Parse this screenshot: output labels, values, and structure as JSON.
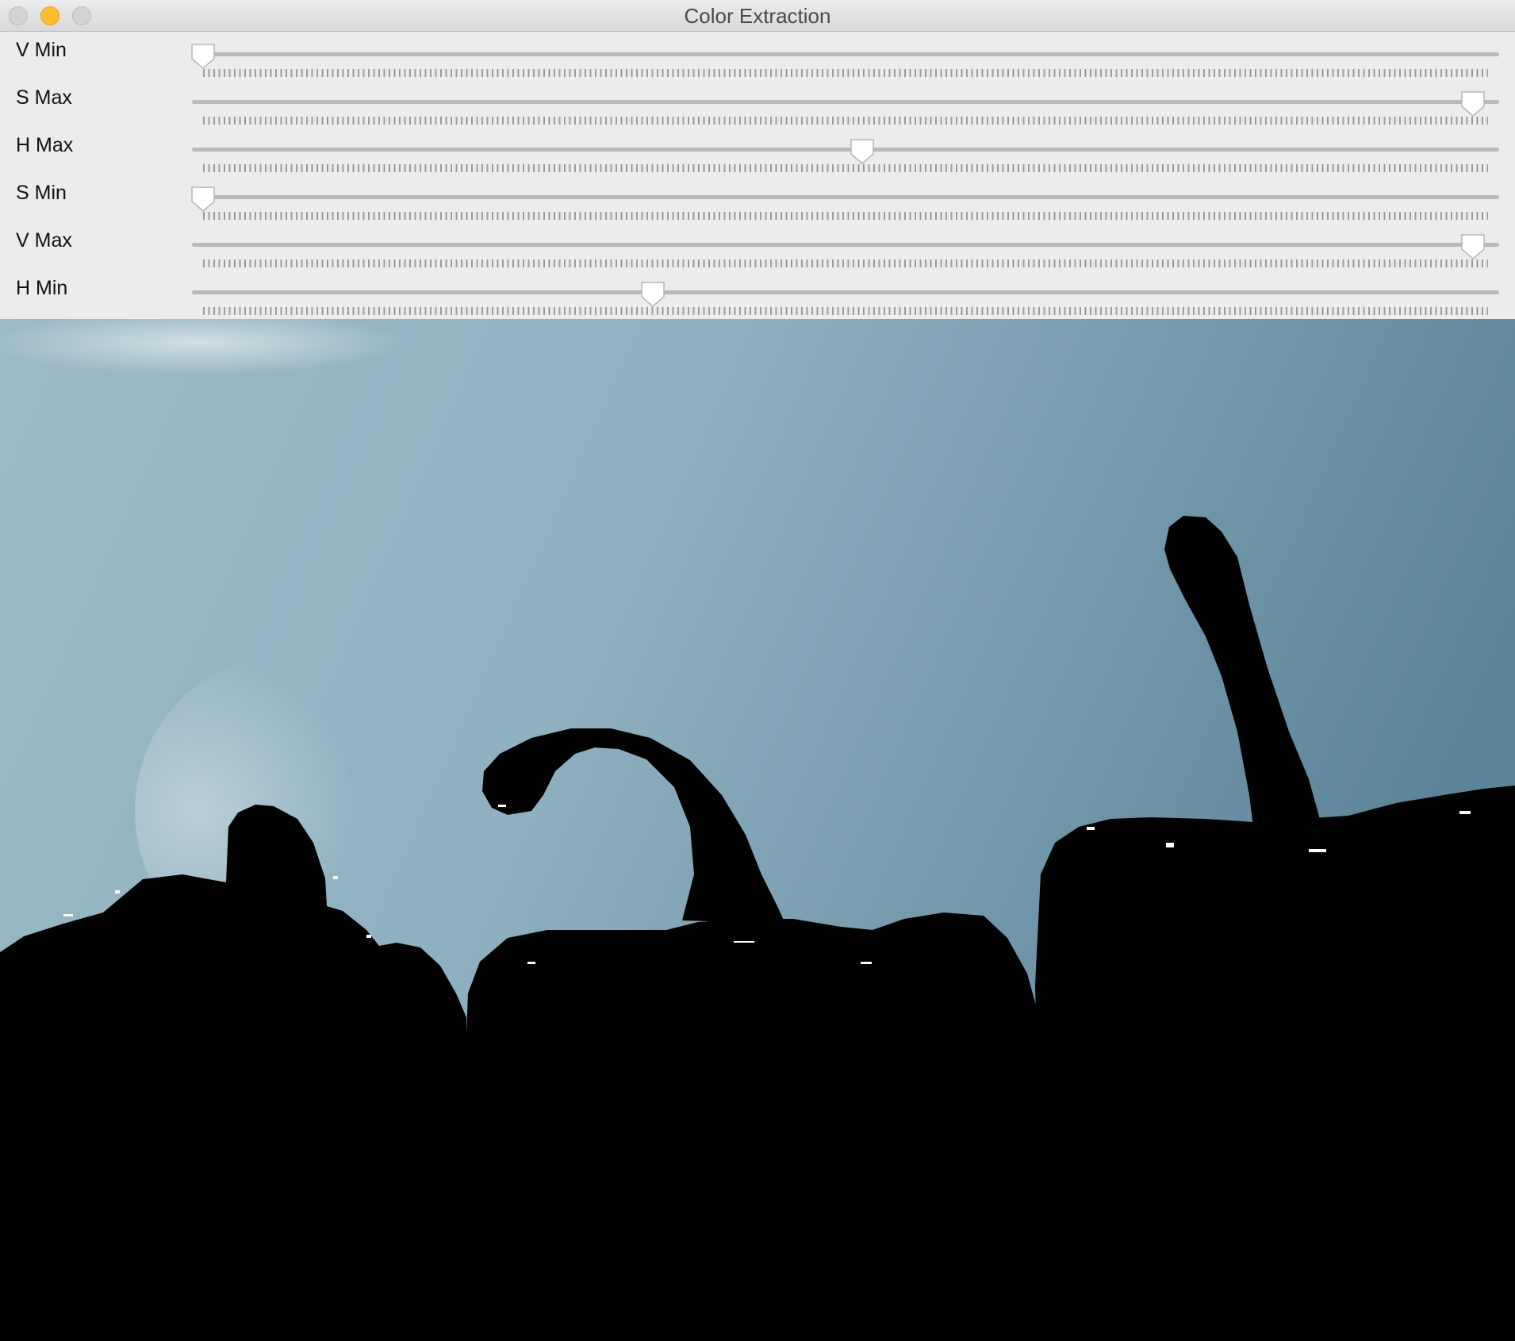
{
  "window": {
    "title": "Color Extraction"
  },
  "sliders": [
    {
      "label": "V Min",
      "value": 0.0
    },
    {
      "label": "S Max",
      "value": 0.988
    },
    {
      "label": "H Max",
      "value": 0.513
    },
    {
      "label": "S Min",
      "value": 0.0
    },
    {
      "label": "V Max",
      "value": 0.988
    },
    {
      "label": "H Min",
      "value": 0.35
    }
  ],
  "image": {
    "description_icon": "extraction-result-image",
    "background_color": "#8fb0c0",
    "mask_color": "#000000"
  }
}
